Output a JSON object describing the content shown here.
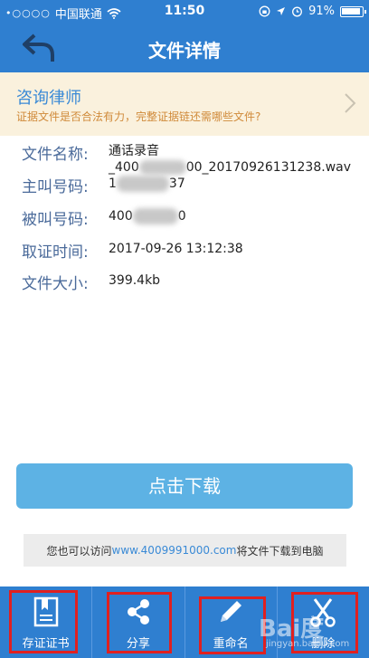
{
  "status_bar": {
    "signal": "•○○○○",
    "carrier": "中国联通",
    "time": "11:50",
    "battery": "91%"
  },
  "nav": {
    "title": "文件详情"
  },
  "lawyer_banner": {
    "title": "咨询律师",
    "desc": "证据文件是否合法有力，完整证据链还需哪些文件?"
  },
  "file_info": {
    "name_label": "文件名称:",
    "name_line1": "通话录音",
    "name_line2_prefix": "_400",
    "name_line2_suffix": "00_20170926131238.wav",
    "caller_label": "主叫号码:",
    "caller_prefix": "1",
    "caller_suffix": "37",
    "callee_label": "被叫号码:",
    "callee_prefix": "400",
    "callee_suffix": "0",
    "time_label": "取证时间:",
    "time_value": "2017-09-26 13:12:38",
    "size_label": "文件大小:",
    "size_value": "399.4kb"
  },
  "download": {
    "label": "点击下载"
  },
  "visit": {
    "prefix": "您也可以访问",
    "url": "www.4009991000.com",
    "suffix": "将文件下载到电脑"
  },
  "toolbar": {
    "items": [
      {
        "label": "存证证书",
        "icon": "certificate-icon"
      },
      {
        "label": "分享",
        "icon": "share-icon"
      },
      {
        "label": "重命名",
        "icon": "pencil-icon"
      },
      {
        "label": "删除",
        "icon": "scissors-icon"
      }
    ]
  },
  "watermark": {
    "brand": "Bai度",
    "site": "jingyan.baidu.com"
  },
  "colors": {
    "primary": "#2f7fd0",
    "button": "#5db2e4",
    "banner_bg": "#faf1dd",
    "highlight": "#e02020"
  }
}
